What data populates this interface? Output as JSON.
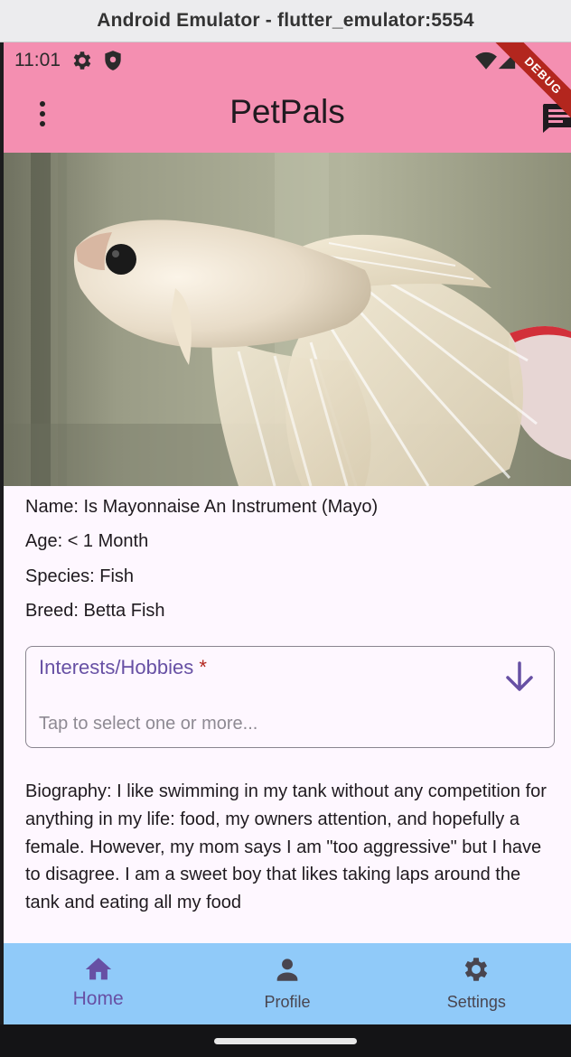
{
  "window": {
    "title": "Android Emulator - flutter_emulator:5554"
  },
  "status_bar": {
    "time": "11:01"
  },
  "debug_banner": "DEBUG",
  "app_bar": {
    "title": "PetPals"
  },
  "pet": {
    "name_line": "Name: Is Mayonnaise An Instrument (Mayo)",
    "age_line": "Age: < 1 Month",
    "species_line": "Species: Fish",
    "breed_line": "Breed: Betta Fish"
  },
  "interests_field": {
    "label": "Interests/Hobbies",
    "required_mark": "*",
    "placeholder": "Tap to select one or more..."
  },
  "biography": "Biography: I like swimming in my tank without any competition for anything in my life: food, my owners attention, and hopefully a female. However, my mom says I am \"too aggressive\" but I have to disagree. I am a sweet boy that likes taking laps around the tank and eating all my food",
  "bottom_nav": {
    "items": [
      {
        "label": "Home",
        "icon": "home-icon",
        "active": true
      },
      {
        "label": "Profile",
        "icon": "person-icon",
        "active": false
      },
      {
        "label": "Settings",
        "icon": "gear-icon",
        "active": false
      }
    ]
  },
  "colors": {
    "app_bar": "#f48fb1",
    "nav_bar": "#90caf9",
    "accent": "#6750a4",
    "background": "#fef7ff",
    "debug_banner": "#b3261e"
  }
}
